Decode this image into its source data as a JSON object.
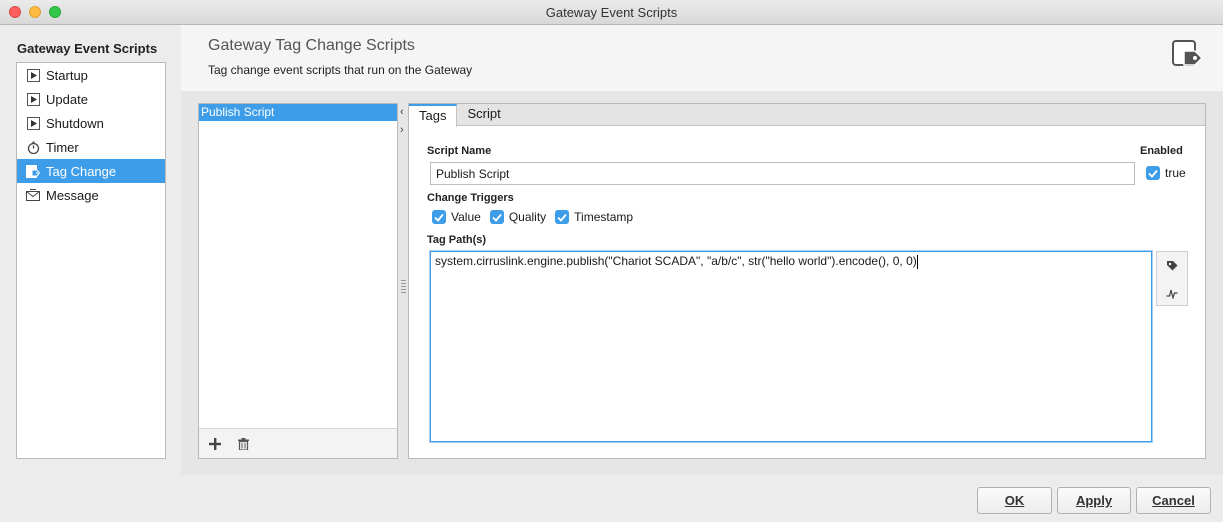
{
  "window": {
    "title": "Gateway Event Scripts"
  },
  "sidebar": {
    "heading": "Gateway Event Scripts",
    "items": [
      {
        "label": "Startup",
        "icon": "play-page-icon",
        "selected": false
      },
      {
        "label": "Update",
        "icon": "play-page-icon",
        "selected": false
      },
      {
        "label": "Shutdown",
        "icon": "play-page-icon",
        "selected": false
      },
      {
        "label": "Timer",
        "icon": "stopwatch-icon",
        "selected": false
      },
      {
        "label": "Tag Change",
        "icon": "tag-change-icon",
        "selected": true
      },
      {
        "label": "Message",
        "icon": "envelope-icon",
        "selected": false
      }
    ]
  },
  "header": {
    "title": "Gateway Tag Change Scripts",
    "subtitle": "Tag change event scripts that run on the Gateway",
    "icon": "tag-script-icon"
  },
  "scripts": {
    "items": [
      "Publish Script"
    ],
    "selected": "Publish Script",
    "add_icon": "plus-icon",
    "delete_icon": "trash-icon"
  },
  "tabs": [
    {
      "label": "Tags",
      "active": true
    },
    {
      "label": "Script",
      "active": false
    }
  ],
  "form": {
    "script_name_label": "Script Name",
    "script_name_value": "Publish Script",
    "enabled_label": "Enabled",
    "enabled_value": "true",
    "change_triggers_label": "Change Triggers",
    "triggers": [
      {
        "label": "Value",
        "checked": true
      },
      {
        "label": "Quality",
        "checked": true
      },
      {
        "label": "Timestamp",
        "checked": true
      }
    ],
    "tag_paths_label": "Tag Path(s)",
    "tag_paths_value": "system.cirruslink.engine.publish(\"Chariot SCADA\", \"a/b/c\", str(\"hello world\").encode(), 0, 0)"
  },
  "footer": {
    "ok_label": "OK",
    "apply_label": "Apply",
    "cancel_label": "Cancel"
  },
  "colors": {
    "accent": "#3d9de8",
    "selection": "#3d9de8"
  }
}
